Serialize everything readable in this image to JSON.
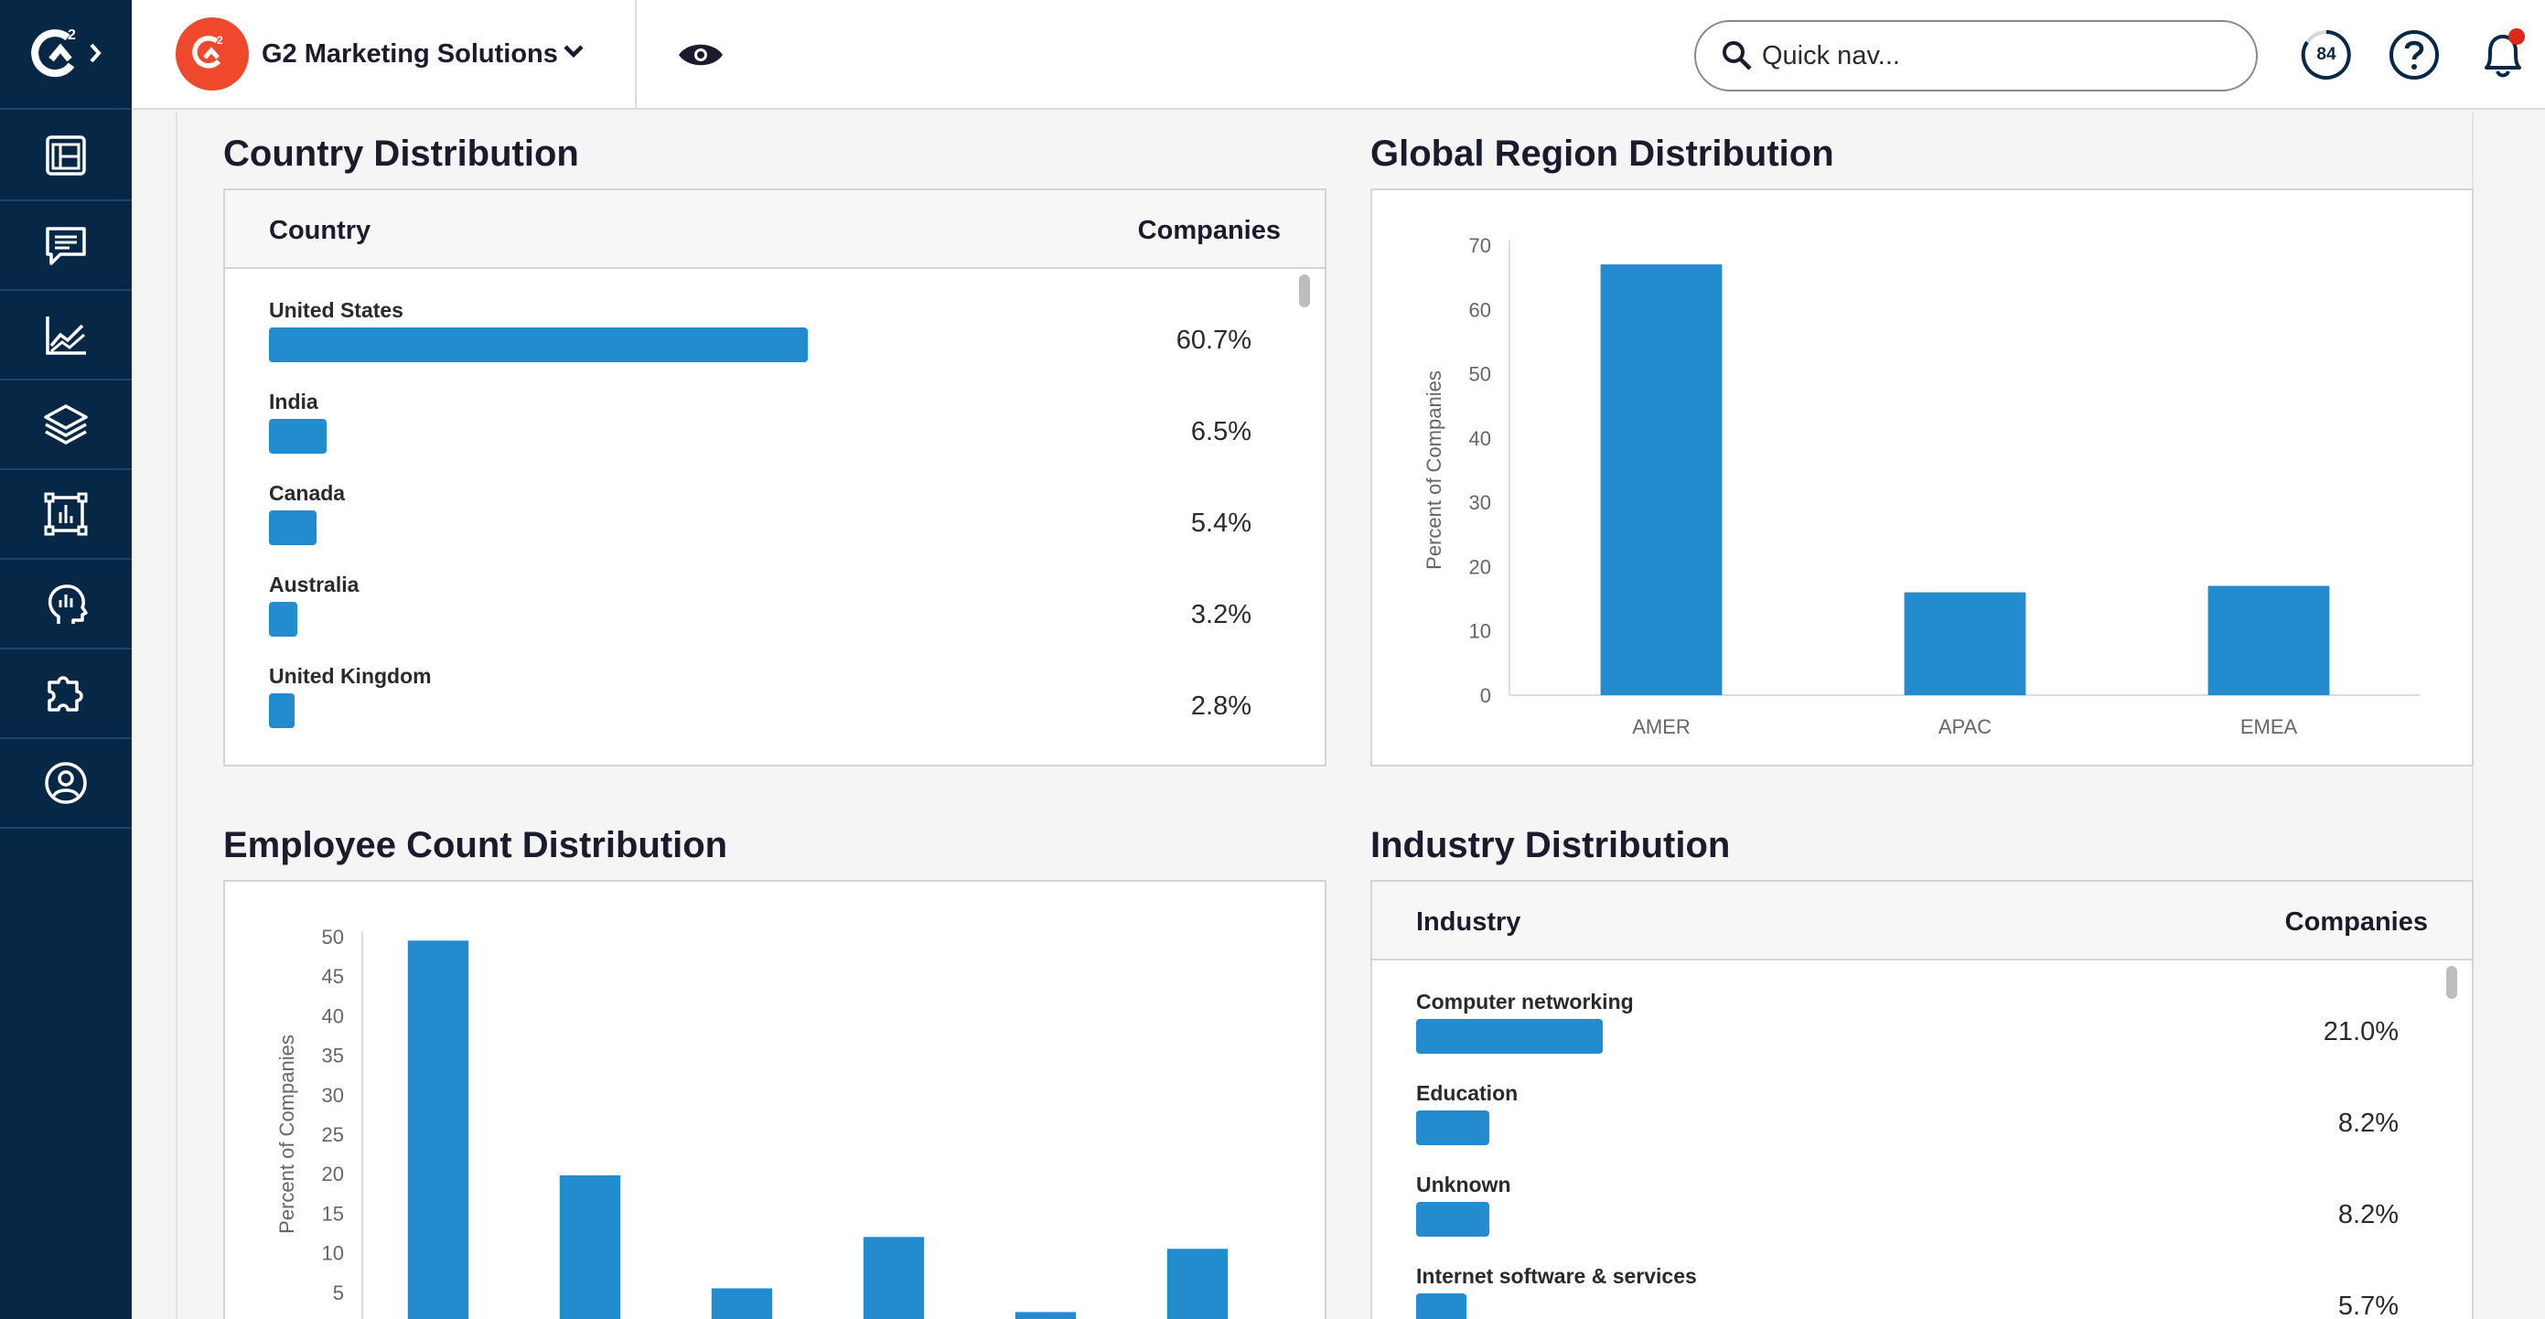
{
  "topbar": {
    "product_name": "G2 Marketing Solutions",
    "search_placeholder": "Quick nav...",
    "score": "84"
  },
  "sidebar": {
    "items": [
      "dashboard-icon",
      "messages-icon",
      "analytics-icon",
      "layers-icon",
      "reports-icon",
      "buyer-intent-icon",
      "integrations-icon",
      "account-icon"
    ]
  },
  "country": {
    "title": "Country Distribution",
    "col_left": "Country",
    "col_right": "Companies",
    "rows": [
      {
        "label": "United States",
        "value": "60.7%",
        "pct": 60.7
      },
      {
        "label": "India",
        "value": "6.5%",
        "pct": 6.5
      },
      {
        "label": "Canada",
        "value": "5.4%",
        "pct": 5.4
      },
      {
        "label": "Australia",
        "value": "3.2%",
        "pct": 3.2
      },
      {
        "label": "United Kingdom",
        "value": "2.8%",
        "pct": 2.8
      }
    ]
  },
  "industry": {
    "title": "Industry Distribution",
    "col_left": "Industry",
    "col_right": "Companies",
    "rows": [
      {
        "label": "Computer networking",
        "value": "21.0%",
        "pct": 21.0
      },
      {
        "label": "Education",
        "value": "8.2%",
        "pct": 8.2
      },
      {
        "label": "Unknown",
        "value": "8.2%",
        "pct": 8.2
      },
      {
        "label": "Internet software & services",
        "value": "5.7%",
        "pct": 5.7
      }
    ]
  },
  "region_title": "Global Region Distribution",
  "employee_title": "Employee Count Distribution",
  "chart_data": [
    {
      "type": "bar",
      "categories": [
        "AMER",
        "APAC",
        "EMEA"
      ],
      "values": [
        67,
        16,
        17
      ],
      "xlabel": "Global Region",
      "ylabel": "Percent of Companies",
      "ylim": [
        0,
        70
      ],
      "yticks": [
        0,
        10,
        20,
        30,
        40,
        50,
        60,
        70
      ],
      "color": "#238ccf",
      "grid": false
    },
    {
      "type": "bar",
      "categories": [
        "",
        "",
        "",
        "",
        "",
        ""
      ],
      "values": [
        49.5,
        19.8,
        5.5,
        12,
        2.5,
        10.5
      ],
      "xlabel": "",
      "ylabel": "Percent of Companies",
      "ylim": [
        0,
        50
      ],
      "yticks": [
        5,
        10,
        15,
        20,
        25,
        30,
        35,
        40,
        45,
        50
      ],
      "color": "#238ccf",
      "grid": false
    }
  ]
}
